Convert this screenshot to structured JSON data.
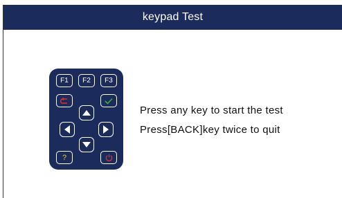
{
  "window": {
    "title": "keypad Test"
  },
  "keypad": {
    "f1_label": "F1",
    "f2_label": "F2",
    "f3_label": "F3",
    "help_label": "?",
    "back_icon": "back-arrow-icon",
    "ok_icon": "checkmark-icon",
    "power_icon": "power-icon",
    "up_icon": "triangle-up-icon",
    "down_icon": "triangle-down-icon",
    "left_icon": "triangle-left-icon",
    "right_icon": "triangle-right-icon"
  },
  "instructions": {
    "line1": "Press any key to start the test",
    "line2": "Press[BACK]key twice to quit"
  },
  "colors": {
    "title_bar": "#1b2b5b",
    "keypad_body": "#1b2b5b",
    "back_key": "#e03030",
    "ok_key": "#3cb043",
    "help_key": "#e8d020",
    "power_key": "#e03030"
  }
}
